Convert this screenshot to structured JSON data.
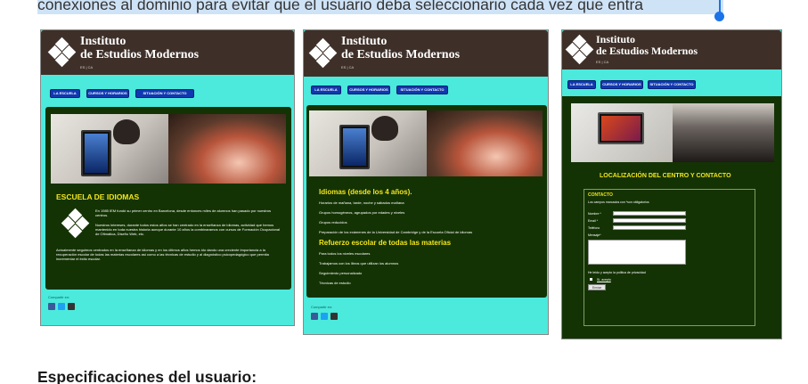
{
  "doc": {
    "top_text": "conexiones al dominio para evitar que el usuario deba seleccionario cada vez que entra",
    "specs_heading": "Especificaciones del usuario:"
  },
  "site": {
    "brand_line1": "Instituto",
    "brand_line2": "de Estudios Modernos",
    "lang": "ES | CA",
    "nav": [
      "LA ESCUELA",
      "CURSOS Y HORARIOS",
      "SITUACIÓN Y CONTACTO"
    ],
    "share": "Compartir en:"
  },
  "shot1": {
    "title": "ESCUELA DE IDIOMAS",
    "p1": "En 1985 IEM fundó su primer centro en Barcelona, desde entonces miles de alumnos han pasado por nuestros centros.",
    "p2": "Nuestros intereses, durante todos estos años se han centrado en la enseñanza de idiomas, actividad que hemos mantenido en toda nuestra historia aunque durante 10 años la combinaramos con cursos de Formación Ocupacional de Ofimática, Diseño Web, etc.",
    "p3": "Actualmente seguimos centrados en la enseñanza de idiomas y en los últimos años hemos ido dando una creciente importancia a la recuperación escolar de todas las materias escolares así como a las técnicas de estudio y al diagnóstico psicopedagógico que permita incrementar el éxito escolar."
  },
  "shot2": {
    "title1": "Idiomas (desde los 4 años).",
    "lines1": [
      "Horarios de mañana, tarde, noche y sábados mañana",
      "Grupos homogéneos, agrupados por edades y niveles",
      "Grupos reducidos",
      "Preparación de los exámenes de la Universidad de Cambridge y de la Escuela Oficial de idiomas"
    ],
    "title2": "Refuerzo escolar de todas las materias",
    "lines2": [
      "Para todos los niveles escolares",
      "Trabajamos con los libros que utilizan los alumnos",
      "Seguimiento personalizado",
      "Técnicas de estudio"
    ]
  },
  "shot3": {
    "title": "LOCALIZACIÓN DEL CENTRO Y CONTACTO",
    "contact_title": "CONTACTO",
    "required_note": "Los campos marcados con *son obligatorios",
    "fields": [
      "Nombre *",
      "Email *",
      "Teléfono",
      "Mensaje*"
    ],
    "privacy": "He leído y acepto la política de privacidad",
    "yes": "Sí, acepto",
    "send": "Enviar"
  },
  "colors": {
    "header_brown": "#3e3028",
    "nav_cyan": "#4beadc",
    "nav_button": "#1038b0",
    "panel_green": "#143304",
    "title_yellow": "#f2e61c",
    "selection_blue": "#cfe3f7",
    "cursor_blue": "#1a73e8"
  },
  "icons": [
    "diamond-logo-icon",
    "facebook-icon",
    "twitter-icon",
    "google-plus-icon"
  ]
}
